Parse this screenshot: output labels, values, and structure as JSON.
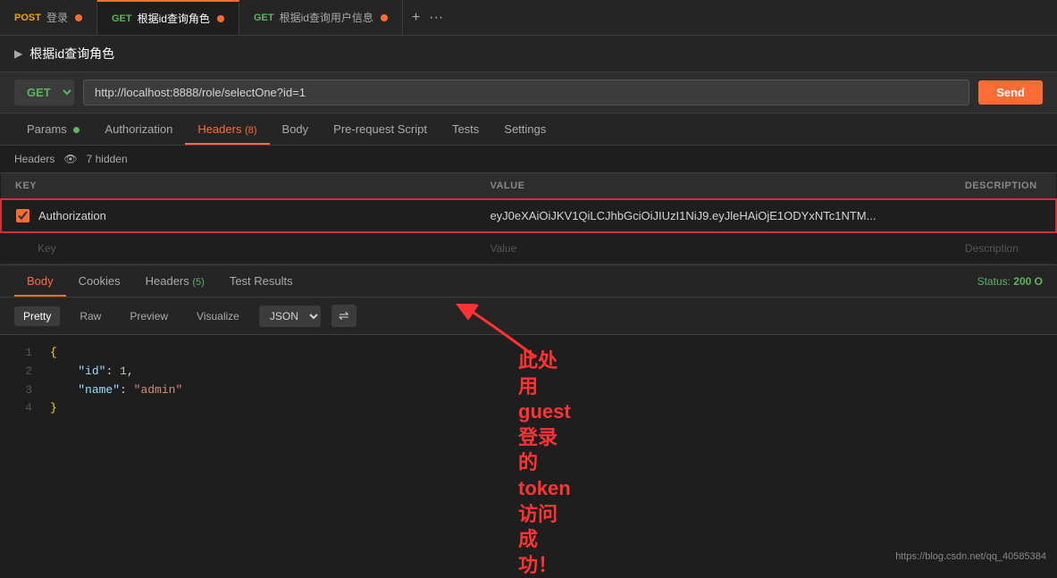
{
  "tabs": [
    {
      "method": "POST",
      "method_type": "post",
      "label": "登录",
      "active": false
    },
    {
      "method": "GET",
      "method_type": "get",
      "label": "根据id查询角色",
      "active": true
    },
    {
      "method": "GET",
      "method_type": "get",
      "label": "根据id查询用户信息",
      "active": false
    }
  ],
  "tab_add": "+",
  "tab_more": "···",
  "request_name": "根据id查询角色",
  "method": "GET",
  "url": "http://localhost:8888/role/selectOne?id=1",
  "nav_tabs": [
    {
      "label": "Params",
      "badge": "",
      "dot": true,
      "active": false
    },
    {
      "label": "Authorization",
      "badge": "",
      "dot": false,
      "active": false
    },
    {
      "label": "Headers",
      "badge": "(8)",
      "dot": false,
      "active": true
    },
    {
      "label": "Body",
      "badge": "",
      "dot": false,
      "active": false
    },
    {
      "label": "Pre-request Script",
      "badge": "",
      "dot": false,
      "active": false
    },
    {
      "label": "Tests",
      "badge": "",
      "dot": false,
      "active": false
    },
    {
      "label": "Settings",
      "badge": "",
      "dot": false,
      "active": false
    }
  ],
  "headers_label": "Headers",
  "hidden_count": "7 hidden",
  "table_headers": [
    "KEY",
    "VALUE",
    "DESCRIPTION"
  ],
  "auth_row": {
    "checked": true,
    "key": "Authorization",
    "value": "eyJ0eXAiOiJKV1QiLCJhbGciOiJIUzI1NiJ9.eyJleHAiOjE1ODYxNTc1NTM...",
    "description": ""
  },
  "placeholder_row": {
    "key": "Key",
    "value": "Value",
    "description": "Description"
  },
  "response_tabs": [
    {
      "label": "Body",
      "active": true
    },
    {
      "label": "Cookies",
      "active": false
    },
    {
      "label": "Headers",
      "badge": "(5)",
      "active": false
    },
    {
      "label": "Test Results",
      "active": false
    }
  ],
  "status_label": "Status:",
  "status_code": "200 O",
  "format_btns": [
    "Pretty",
    "Raw",
    "Preview",
    "Visualize"
  ],
  "active_format": "Pretty",
  "format_type": "JSON",
  "json_lines": [
    {
      "num": "1",
      "content_type": "brace",
      "content": "{"
    },
    {
      "num": "2",
      "content_type": "keyval",
      "key": "\"id\"",
      "sep": ": ",
      "value": "1",
      "value_type": "number",
      "comma": ","
    },
    {
      "num": "3",
      "content_type": "keyval",
      "key": "\"name\"",
      "sep": ": ",
      "value": "\"admin\"",
      "value_type": "string",
      "comma": ""
    },
    {
      "num": "4",
      "content_type": "brace",
      "content": "}"
    }
  ],
  "annotation_line1": "此处用guest登录的token",
  "annotation_line2": "访问成功！",
  "watermark": "https://blog.csdn.net/qq_40585384"
}
